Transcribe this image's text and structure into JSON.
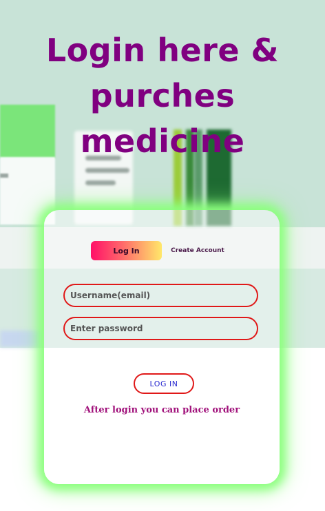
{
  "header": {
    "title_line1": "Login here &",
    "title_line2": "purches",
    "title_line3": "medicine"
  },
  "auth": {
    "tabs": {
      "login_label": "Log In",
      "create_label": "Create Account"
    },
    "username_placeholder": "Username(email)",
    "password_placeholder": "Enter password",
    "submit_label": "LOG IN",
    "note": "After login you can place order"
  },
  "colors": {
    "title": "#800080",
    "card_glow": "#8cff7e",
    "field_border": "#e01818",
    "submit_text": "#2a2ad0",
    "note": "#a0107a",
    "tab_gradient": [
      "#ff1068",
      "#ffe86a"
    ]
  }
}
